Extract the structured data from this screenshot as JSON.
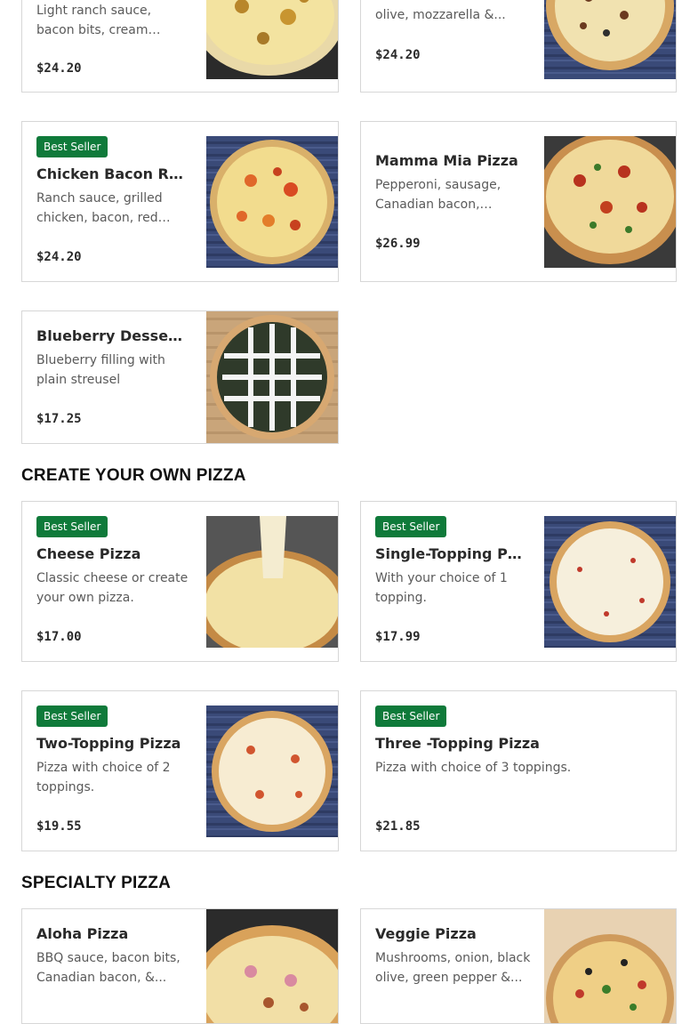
{
  "sections": {
    "create_your_own": "CREATE YOUR OWN PIZZA",
    "specialty": "SPECIALTY PIZZA"
  },
  "colors": {
    "badge": "#0f7a3a",
    "border": "#d7d7d7"
  },
  "top_cards": [
    {
      "name": "",
      "desc": "Light ranch sauce, bacon bits, cream cheese,...",
      "price": "$24.20"
    },
    {
      "name": "",
      "desc": "olive, mozzarella &...",
      "price": "$24.20"
    }
  ],
  "cards": [
    {
      "badge": "Best Seller",
      "name": "Chicken Bacon Ranc...",
      "desc": "Ranch sauce, grilled chicken, bacon, red onio...",
      "price": "$24.20"
    },
    {
      "badge": "",
      "name": "Mamma Mia Pizza",
      "desc": "Pepperoni, sausage, Canadian bacon, tomato...",
      "price": "$26.99"
    },
    {
      "badge": "",
      "name": "Blueberry Dessert...",
      "desc": "Blueberry filling with plain streusel",
      "price": "$17.25"
    }
  ],
  "create_cards": [
    {
      "badge": "Best Seller",
      "name": "Cheese Pizza",
      "desc": "Classic cheese or create your own pizza.",
      "price": "$17.00"
    },
    {
      "badge": "Best Seller",
      "name": "Single-Topping Pizza",
      "desc": "With your choice of 1 topping.",
      "price": "$17.99"
    },
    {
      "badge": "Best Seller",
      "name": "Two-Topping Pizza",
      "desc": "Pizza with choice of 2 toppings.",
      "price": "$19.55"
    },
    {
      "badge": "Best Seller",
      "name": "Three -Topping Pizza",
      "desc": "Pizza with choice of 3 toppings.",
      "price": "$21.85"
    }
  ],
  "specialty_cards": [
    {
      "name": "Aloha Pizza",
      "desc": "BBQ sauce, bacon bits, Canadian bacon, &..."
    },
    {
      "name": "Veggie Pizza",
      "desc": "Mushrooms, onion, black olive, green pepper &..."
    }
  ]
}
